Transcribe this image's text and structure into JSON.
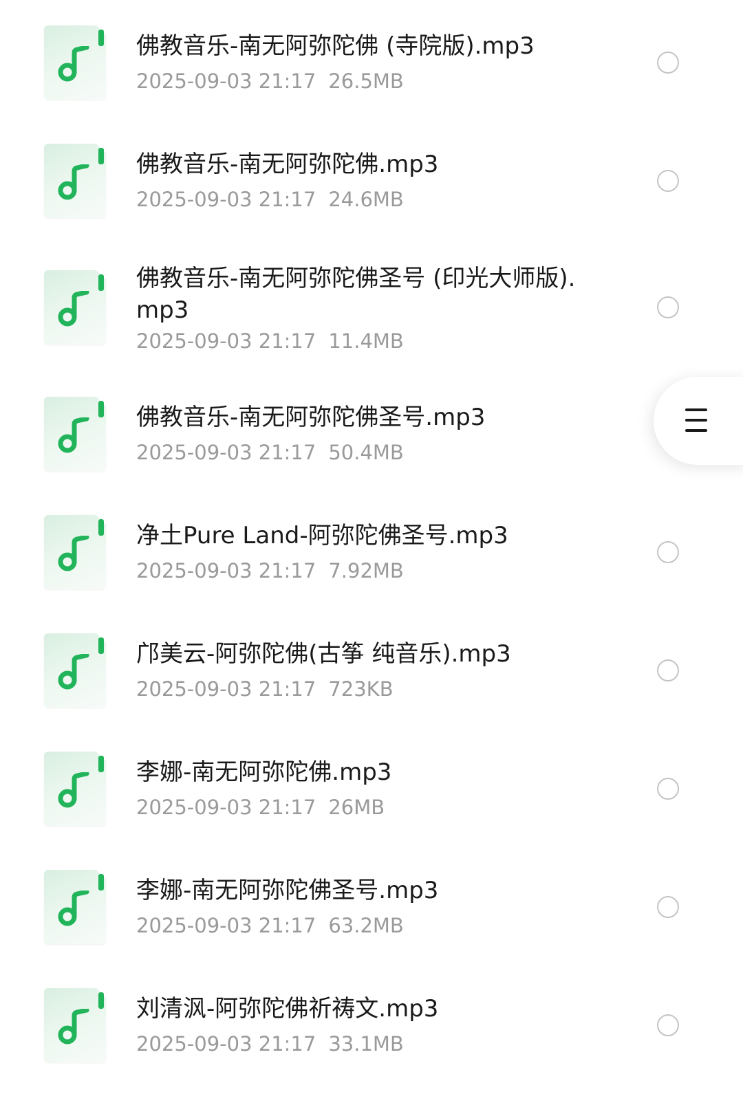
{
  "files": [
    {
      "name": "佛教音乐-南无阿弥陀佛 (寺院版).mp3",
      "date": "2025-09-03 21:17",
      "size": "26.5MB"
    },
    {
      "name": "佛教音乐-南无阿弥陀佛.mp3",
      "date": "2025-09-03 21:17",
      "size": "24.6MB"
    },
    {
      "name": "佛教音乐-南无阿弥陀佛圣号 (印光大师版).mp3",
      "date": "2025-09-03 21:17",
      "size": "11.4MB"
    },
    {
      "name": "佛教音乐-南无阿弥陀佛圣号.mp3",
      "date": "2025-09-03 21:17",
      "size": "50.4MB"
    },
    {
      "name": "净土Pure Land-阿弥陀佛圣号.mp3",
      "date": "2025-09-03 21:17",
      "size": "7.92MB"
    },
    {
      "name": "邝美云-阿弥陀佛(古筝 纯音乐).mp3",
      "date": "2025-09-03 21:17",
      "size": "723KB"
    },
    {
      "name": "李娜-南无阿弥陀佛.mp3",
      "date": "2025-09-03 21:17",
      "size": "26MB"
    },
    {
      "name": "李娜-南无阿弥陀佛圣号.mp3",
      "date": "2025-09-03 21:17",
      "size": "63.2MB"
    },
    {
      "name": "刘清沨-阿弥陀佛祈祷文.mp3",
      "date": "2025-09-03 21:17",
      "size": "33.1MB"
    }
  ],
  "colors": {
    "accent": "#22b45a",
    "icon_background": "#e8f5ec",
    "meta_text": "#9a9a9a",
    "title_text": "#1a1a1a",
    "circle_border": "#c4c4c4"
  },
  "icons": {
    "file": "music-note-file-icon",
    "select": "select-circle-icon",
    "menu": "hamburger-menu-icon"
  }
}
